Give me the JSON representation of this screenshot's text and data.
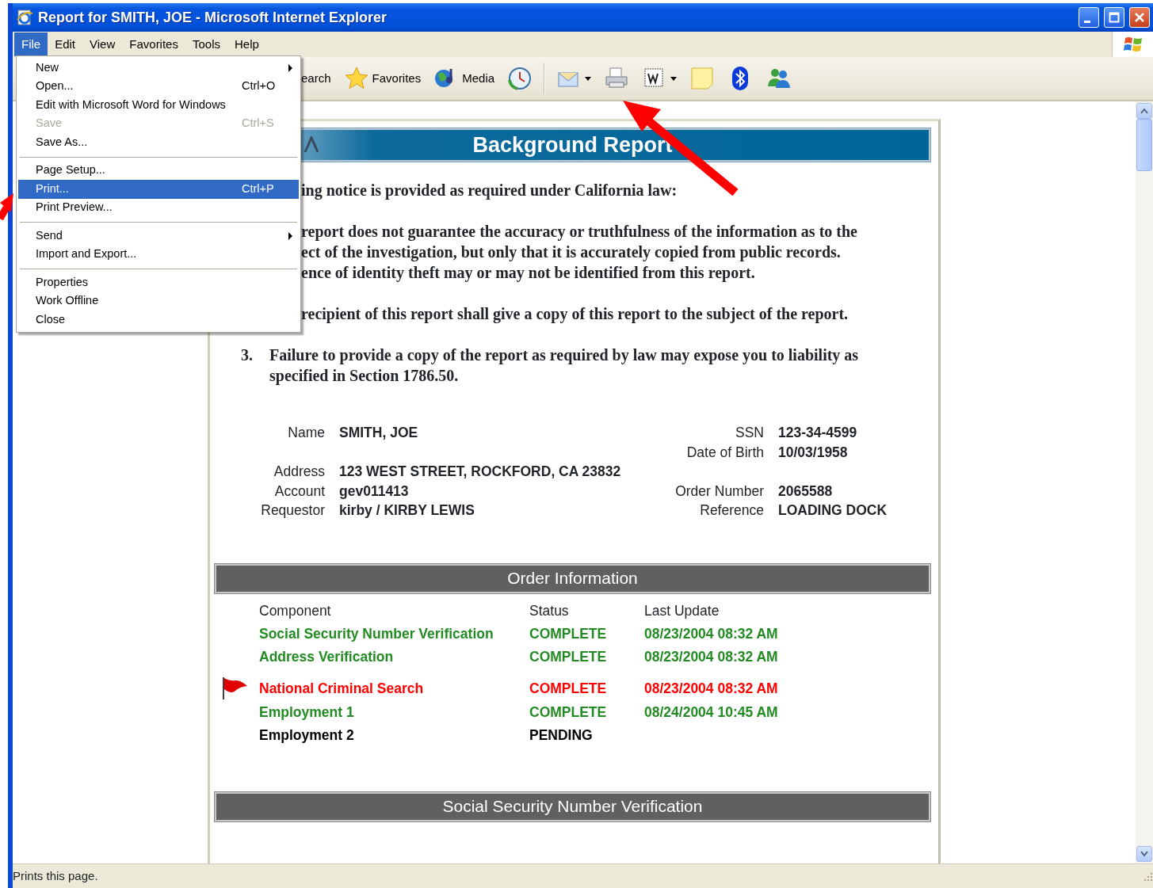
{
  "window": {
    "title": "Report for SMITH, JOE - Microsoft Internet Explorer"
  },
  "menubar": [
    {
      "label": "File",
      "selected": true
    },
    {
      "label": "Edit",
      "selected": false
    },
    {
      "label": "View",
      "selected": false
    },
    {
      "label": "Favorites",
      "selected": false
    },
    {
      "label": "Tools",
      "selected": false
    },
    {
      "label": "Help",
      "selected": false
    }
  ],
  "toolbar": [
    {
      "kind": "search",
      "label": "earch"
    },
    {
      "kind": "favorites",
      "label": "Favorites"
    },
    {
      "kind": "media",
      "label": "Media"
    },
    {
      "kind": "history"
    },
    {
      "kind": "separator"
    },
    {
      "kind": "mail",
      "dropdown": true
    },
    {
      "kind": "print"
    },
    {
      "kind": "word",
      "dropdown": true
    },
    {
      "kind": "note"
    },
    {
      "kind": "bluetooth"
    },
    {
      "kind": "messenger"
    }
  ],
  "file_menu": [
    {
      "kind": "item",
      "label": "New",
      "submenu": true,
      "disabled": false,
      "selected": false
    },
    {
      "kind": "item",
      "label": "Open...",
      "shortcut": "Ctrl+O",
      "submenu": false,
      "disabled": false,
      "selected": false
    },
    {
      "kind": "item",
      "label": "Edit with Microsoft Word for Windows",
      "submenu": false,
      "disabled": false,
      "selected": false
    },
    {
      "kind": "item",
      "label": "Save",
      "shortcut": "Ctrl+S",
      "submenu": false,
      "disabled": true,
      "selected": false
    },
    {
      "kind": "item",
      "label": "Save As...",
      "submenu": false,
      "disabled": false,
      "selected": false
    },
    {
      "kind": "separator"
    },
    {
      "kind": "item",
      "label": "Page Setup...",
      "submenu": false,
      "disabled": false,
      "selected": false
    },
    {
      "kind": "item",
      "label": "Print...",
      "shortcut": "Ctrl+P",
      "submenu": false,
      "disabled": false,
      "selected": true
    },
    {
      "kind": "item",
      "label": "Print Preview...",
      "submenu": false,
      "disabled": false,
      "selected": false
    },
    {
      "kind": "separator"
    },
    {
      "kind": "item",
      "label": "Send",
      "submenu": true,
      "disabled": false,
      "selected": false
    },
    {
      "kind": "item",
      "label": "Import and Export...",
      "submenu": false,
      "disabled": false,
      "selected": false
    },
    {
      "kind": "separator"
    },
    {
      "kind": "item",
      "label": "Properties",
      "submenu": false,
      "disabled": false,
      "selected": false
    },
    {
      "kind": "item",
      "label": "Work Offline",
      "submenu": false,
      "disabled": false,
      "selected": false
    },
    {
      "kind": "item",
      "label": "Close",
      "submenu": false,
      "disabled": false,
      "selected": false
    }
  ],
  "report": {
    "title": "Background Report",
    "notice": [
      {
        "lines": [
          "ing notice is provided as required under California law:"
        ]
      },
      {
        "lines": [
          "report does not guarantee the accuracy or truthfulness of the information as to the",
          "ect of the investigation, but only that it is accurately copied from public records.",
          "ence of identity theft may or may not be identified from this report."
        ]
      },
      {
        "lines": [
          "recipient of this report shall give a copy of this report to the subject of the report."
        ]
      }
    ],
    "numbered": [
      {
        "number": "3.",
        "text": "Failure to provide a copy of the report as required by law may expose you to liability as specified in Section 1786.50."
      }
    ],
    "subject": [
      {
        "left": {
          "label": "Name",
          "value": "SMITH, JOE"
        },
        "right": {
          "label": "SSN",
          "value": "123-34-4599"
        }
      },
      {
        "right": {
          "label": "Date of Birth",
          "value": "10/03/1958"
        }
      },
      {
        "left": {
          "label": "Address",
          "value": "123 WEST STREET, ROCKFORD, CA 23832"
        }
      },
      {
        "left": {
          "label": "Account",
          "value": "gev011413"
        },
        "right": {
          "label": "Order Number",
          "value": "2065588"
        }
      },
      {
        "left": {
          "label": "Requestor",
          "value": "kirby / KIRBY LEWIS"
        },
        "right": {
          "label": "Reference",
          "value": "LOADING DOCK"
        }
      }
    ],
    "order_information": {
      "title": "Order Information",
      "columns": [
        "Component",
        "Status",
        "Last Update"
      ],
      "rows": [
        {
          "component": "Social Security Number Verification",
          "status": "COMPLETE",
          "last_update": "08/23/2004 08:32 AM",
          "color": "#228b22",
          "flagged": false
        },
        {
          "component": "Address Verification",
          "status": "COMPLETE",
          "last_update": "08/23/2004 08:32 AM",
          "color": "#228b22",
          "flagged": false
        },
        {
          "component": "National Criminal Search",
          "status": "COMPLETE",
          "last_update": "08/23/2004 08:32 AM",
          "color": "#ff0000",
          "flagged": true
        },
        {
          "component": "Employment 1",
          "status": "COMPLETE",
          "last_update": "08/24/2004 10:45 AM",
          "color": "#228b22",
          "flagged": false
        },
        {
          "component": "Employment 2",
          "status": "PENDING",
          "color": "#000000",
          "flagged": false
        }
      ]
    },
    "next_section": {
      "title": "Social Security Number Verification"
    }
  },
  "status_bar": {
    "text": "Prints this page."
  },
  "annotations": [
    {
      "kind": "arrow"
    },
    {
      "kind": "arrow"
    }
  ]
}
